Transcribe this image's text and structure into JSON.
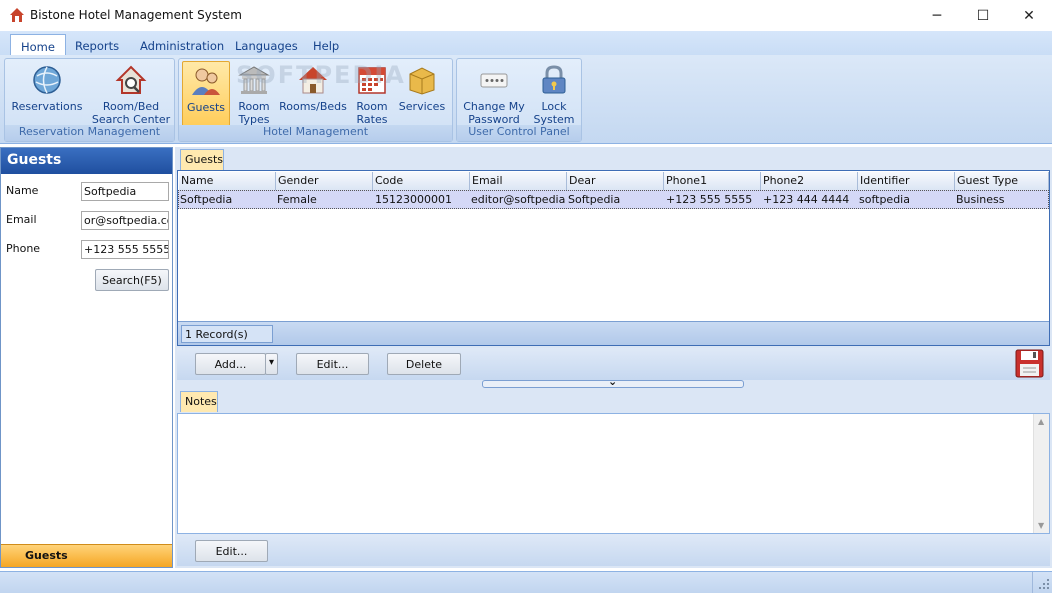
{
  "window": {
    "title": "Bistone Hotel Management System",
    "minimize": "─",
    "maximize": "☐",
    "close": "✕"
  },
  "menu_tabs": [
    "Home",
    "Reports",
    "Administration",
    "Languages",
    "Help"
  ],
  "ribbon": {
    "groups": [
      {
        "caption": "Reservation Management",
        "buttons": [
          {
            "label1": "Reservations",
            "label2": "",
            "icon": "globe-icon"
          },
          {
            "label1": "Room/Bed",
            "label2": "Search Center",
            "icon": "house-search-icon"
          }
        ]
      },
      {
        "caption": "Hotel Management",
        "buttons": [
          {
            "label1": "Guests",
            "label2": "",
            "icon": "guests-icon"
          },
          {
            "label1": "Room",
            "label2": "Types",
            "icon": "building-icon"
          },
          {
            "label1": "Rooms/Beds",
            "label2": "",
            "icon": "house-icon"
          },
          {
            "label1": "Room",
            "label2": "Rates",
            "icon": "calendar-icon"
          },
          {
            "label1": "Services",
            "label2": "",
            "icon": "box-icon"
          }
        ]
      },
      {
        "caption": "User Control Panel",
        "buttons": [
          {
            "label1": "Change My",
            "label2": "Password",
            "icon": "password-icon"
          },
          {
            "label1": "Lock",
            "label2": "System",
            "icon": "lock-icon"
          }
        ]
      }
    ]
  },
  "watermark": "SOFTPEDIA",
  "left_panel": {
    "title": "Guests",
    "fields": [
      {
        "label": "Name",
        "value": "Softpedia"
      },
      {
        "label": "Email",
        "value": "or@softpedia.com"
      },
      {
        "label": "Phone",
        "value": "+123 555 5555"
      }
    ],
    "search_button": "Search(F5)",
    "footer": "Guests"
  },
  "grid": {
    "tab": "Guests",
    "columns": [
      "Name",
      "Gender",
      "Code",
      "Email",
      "Dear",
      "Phone1",
      "Phone2",
      "Identifier",
      "Guest Type"
    ],
    "rows": [
      [
        "Softpedia",
        "Female",
        "15123000001",
        "editor@softpedia.c",
        "Softpedia",
        "+123 555 5555",
        "+123 444 4444",
        "softpedia",
        "Business"
      ]
    ],
    "record_count": "1 Record(s)"
  },
  "actions": {
    "add": "Add...",
    "add_dropdown": "▾",
    "edit": "Edit...",
    "delete": "Delete"
  },
  "notes": {
    "tab": "Notes",
    "edit": "Edit..."
  },
  "splitter_glyph": "⌄",
  "scrollbar": {
    "up": "▲",
    "down": "▼"
  }
}
